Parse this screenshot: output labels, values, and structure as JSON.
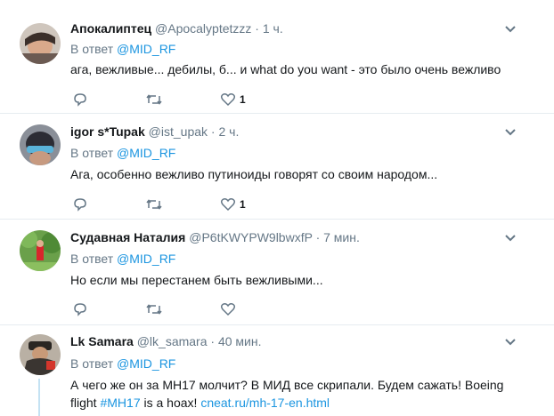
{
  "tweets": [
    {
      "name": "Апокалиптец",
      "handle": "@Apocalyptetzzz",
      "dot": "·",
      "time": "1 ч.",
      "reply_prefix": "В ответ",
      "reply_handle": "@MID_RF",
      "text": "ага, вежливые... дебилы, б... и what do you want - это было очень вежливо",
      "likes": "1"
    },
    {
      "name": "igor s*Tupak",
      "handle": "@ist_upak",
      "dot": "·",
      "time": "2 ч.",
      "reply_prefix": "В ответ",
      "reply_handle": "@MID_RF",
      "text": "Ага, особенно вежливо путиноиды говорят со своим народом...",
      "likes": "1"
    },
    {
      "name": "Судавная Наталия",
      "handle": "@P6tKWYPW9lbwxfP",
      "dot": "·",
      "time": "7 мин.",
      "reply_prefix": "В ответ",
      "reply_handle": "@MID_RF",
      "text": "Но если мы перестанем быть вежливыми...",
      "likes": ""
    },
    {
      "name": "Lk Samara",
      "handle": "@lk_samara",
      "dot": "·",
      "time": "40 мин.",
      "reply_prefix": "В ответ",
      "reply_handle": "@MID_RF",
      "text_line1": "А чего же он за МН17 молчит? В МИД все скрипали. Будем сажать! Boeing",
      "text_line2_prefix": "flight ",
      "hashtag": "#MH17",
      "text_line2_mid": " is a hoax! ",
      "url": "cneat.ru/mh-17-en.html"
    }
  ],
  "colors": {
    "link": "#1b95e0",
    "secondary": "#657786",
    "border": "#e6ecf0"
  },
  "icons": [
    "reply-icon",
    "retweet-icon",
    "like-icon",
    "chevron-down-icon"
  ]
}
